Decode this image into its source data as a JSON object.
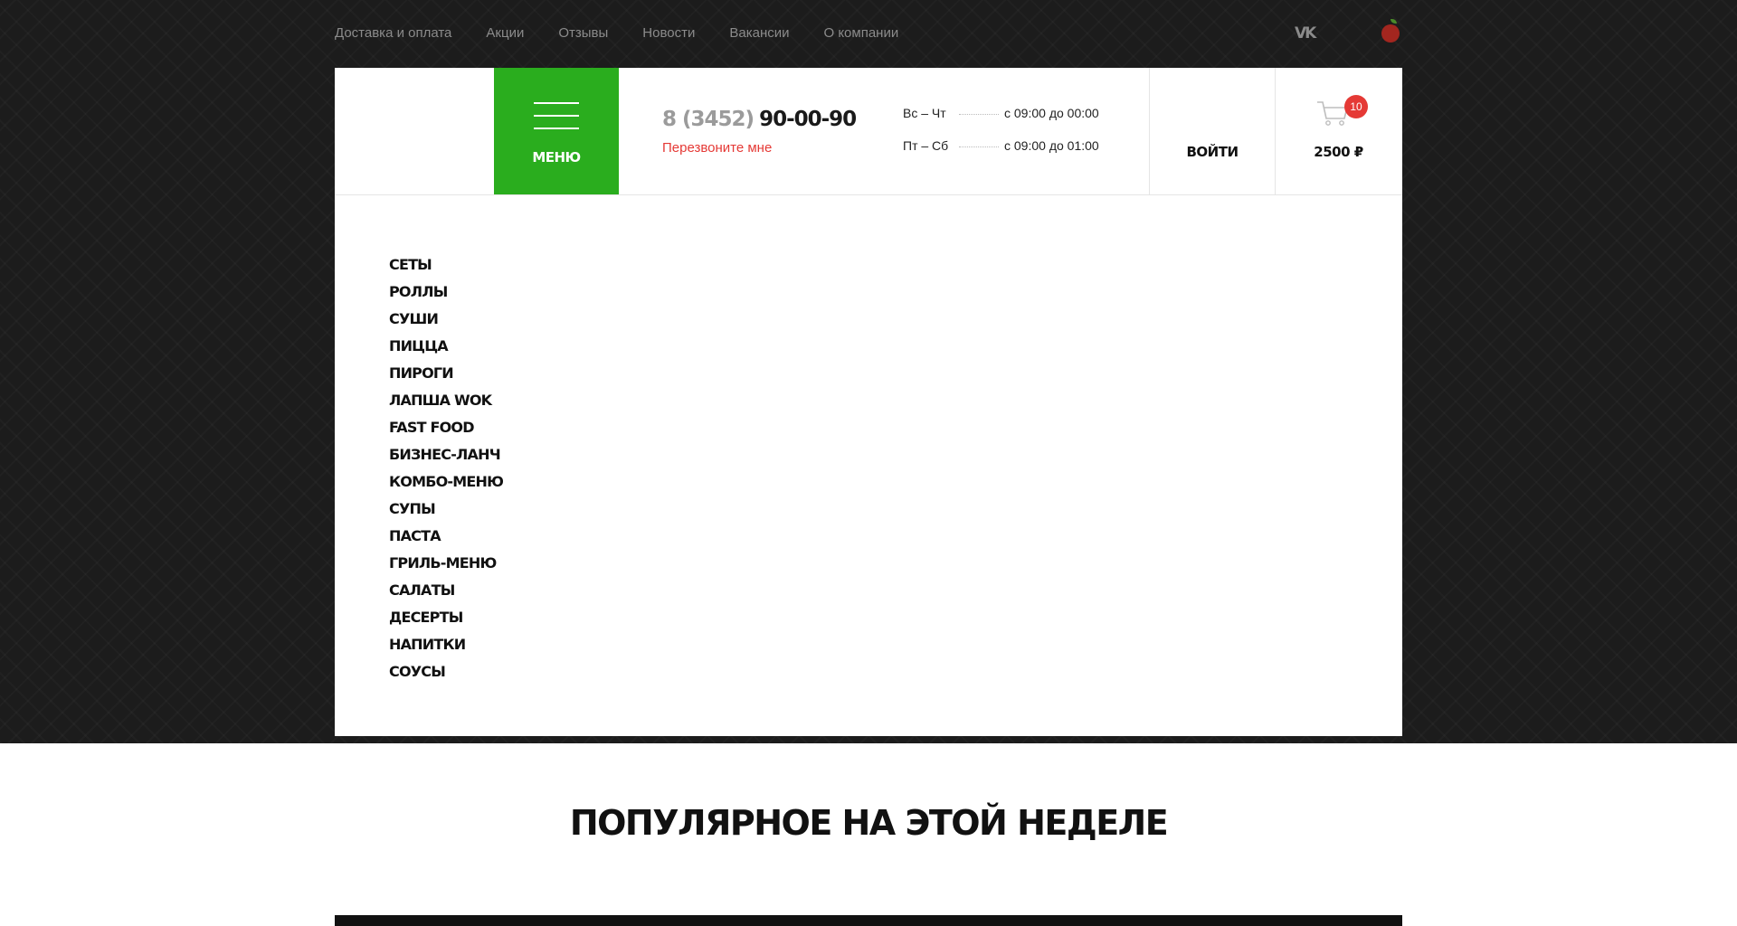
{
  "topnav": {
    "items": [
      {
        "label": "Доставка и оплата"
      },
      {
        "label": "Акции"
      },
      {
        "label": "Отзывы"
      },
      {
        "label": "Новости"
      },
      {
        "label": "Вакансии"
      },
      {
        "label": "О компании"
      }
    ],
    "social_icon": "vk-icon",
    "apple_icon": "apple-icon"
  },
  "header": {
    "menu_label": "Меню",
    "phone_code": "8 (3452)",
    "phone_number": "90-00-90",
    "callback_label": "Перезвоните мне",
    "hours": [
      {
        "days": "Вс – Чт",
        "time": "с 09:00 до 00:00"
      },
      {
        "days": "Пт – Сб",
        "time": "с 09:00 до 01:00"
      }
    ],
    "login_label": "Войти",
    "cart": {
      "count": "10",
      "total": "2500 ₽",
      "icon": "cart-icon"
    }
  },
  "categories": [
    "Сеты",
    "Роллы",
    "Суши",
    "Пицца",
    "Пироги",
    "Лапша WOK",
    "Fast Food",
    "Бизнес-ланч",
    "Комбо-меню",
    "Супы",
    "Паста",
    "Гриль-меню",
    "Салаты",
    "Десерты",
    "Напитки",
    "Соусы"
  ],
  "popular": {
    "title": "Популярное на этой неделе"
  },
  "colors": {
    "accent": "#2aad1e",
    "alert": "#e53935",
    "dark_bg": "#1c1c1c"
  }
}
